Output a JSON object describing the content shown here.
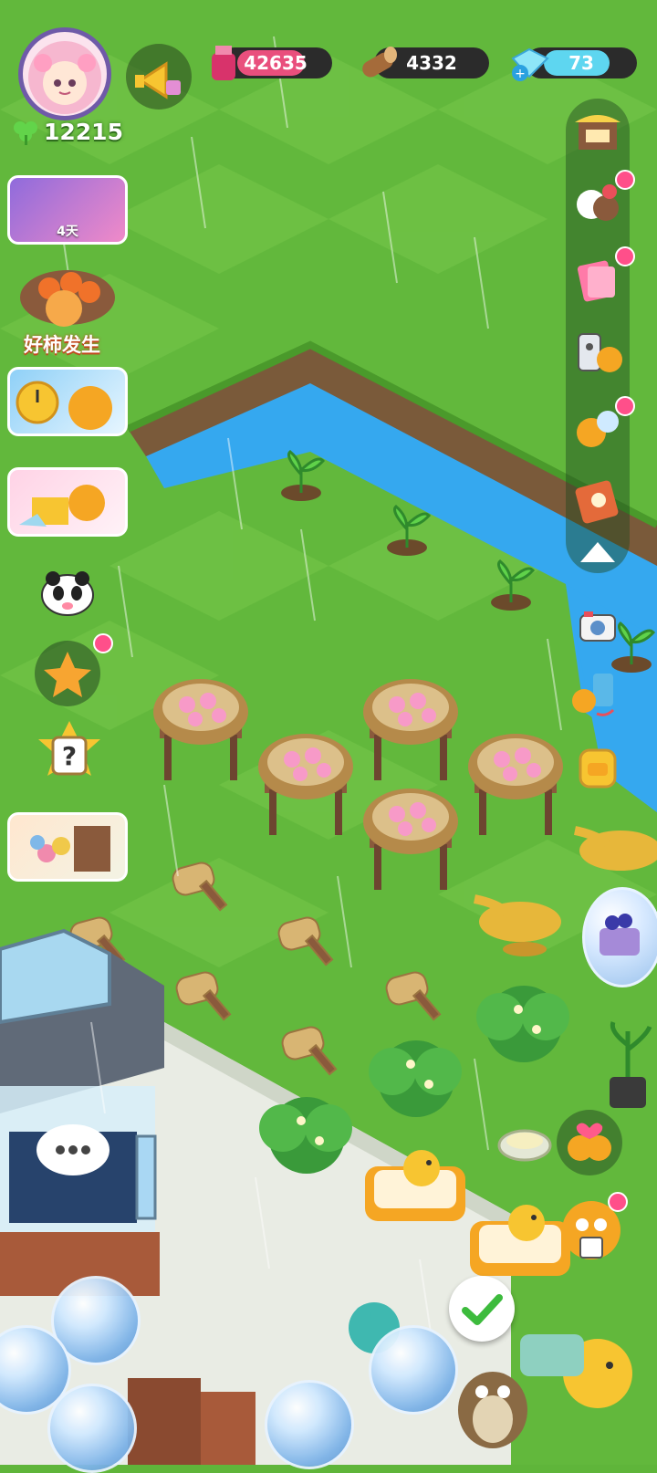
{
  "player": {
    "clover_count": "12215"
  },
  "resources": {
    "ink": {
      "value": "42635",
      "color": "#e94f7d"
    },
    "wood": {
      "value": "4332",
      "color": "#2b2b2b"
    },
    "gems": {
      "value": "73",
      "color": "#5ed6f0"
    }
  },
  "left_menu": {
    "card1_label": "4天",
    "event_title": "好柿发生"
  },
  "icons": {
    "megaphone": "megaphone-icon",
    "avatar": "avatar-portrait",
    "clover": "clover-icon",
    "confirm": "checkmark-icon",
    "collapse": "triangle-up-icon"
  },
  "colors": {
    "grass": "#5fb53a",
    "river": "#35a8ef",
    "badge": "#ff4f8a",
    "check": "#3dbb3d"
  }
}
